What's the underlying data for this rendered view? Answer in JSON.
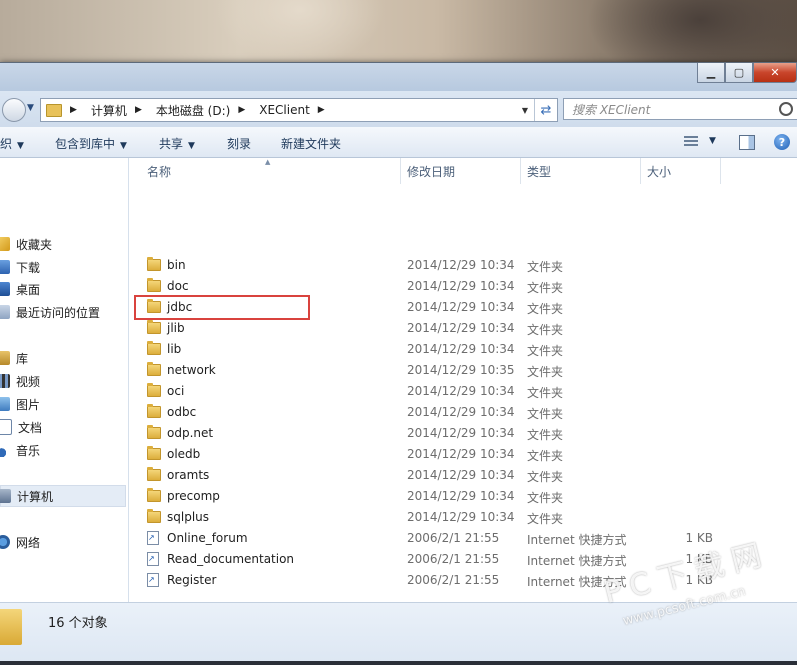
{
  "address": {
    "crumbs": [
      "计算机",
      "本地磁盘 (D:)",
      "XEClient"
    ]
  },
  "search": {
    "placeholder": "搜索 XEClient"
  },
  "toolbar": {
    "organize": "织",
    "include_in_library": "包含到库中",
    "share": "共享",
    "burn": "刻录",
    "new_folder": "新建文件夹"
  },
  "sidebar": {
    "favorites": "收藏夹",
    "downloads": "下载",
    "desktop": "桌面",
    "recent": "最近访问的位置",
    "libraries": "库",
    "videos": "视频",
    "pictures": "图片",
    "documents": "文档",
    "music": "音乐",
    "computer": "计算机",
    "network": "网络"
  },
  "columns": {
    "name": "名称",
    "date": "修改日期",
    "type": "类型",
    "size": "大小"
  },
  "files": [
    {
      "name": "bin",
      "date": "2014/12/29 10:34",
      "type": "文件夹",
      "size": "",
      "kind": "folder"
    },
    {
      "name": "doc",
      "date": "2014/12/29 10:34",
      "type": "文件夹",
      "size": "",
      "kind": "folder"
    },
    {
      "name": "jdbc",
      "date": "2014/12/29 10:34",
      "type": "文件夹",
      "size": "",
      "kind": "folder"
    },
    {
      "name": "jlib",
      "date": "2014/12/29 10:34",
      "type": "文件夹",
      "size": "",
      "kind": "folder"
    },
    {
      "name": "lib",
      "date": "2014/12/29 10:34",
      "type": "文件夹",
      "size": "",
      "kind": "folder"
    },
    {
      "name": "network",
      "date": "2014/12/29 10:35",
      "type": "文件夹",
      "size": "",
      "kind": "folder"
    },
    {
      "name": "oci",
      "date": "2014/12/29 10:34",
      "type": "文件夹",
      "size": "",
      "kind": "folder"
    },
    {
      "name": "odbc",
      "date": "2014/12/29 10:34",
      "type": "文件夹",
      "size": "",
      "kind": "folder"
    },
    {
      "name": "odp.net",
      "date": "2014/12/29 10:34",
      "type": "文件夹",
      "size": "",
      "kind": "folder"
    },
    {
      "name": "oledb",
      "date": "2014/12/29 10:34",
      "type": "文件夹",
      "size": "",
      "kind": "folder"
    },
    {
      "name": "oramts",
      "date": "2014/12/29 10:34",
      "type": "文件夹",
      "size": "",
      "kind": "folder"
    },
    {
      "name": "precomp",
      "date": "2014/12/29 10:34",
      "type": "文件夹",
      "size": "",
      "kind": "folder"
    },
    {
      "name": "sqlplus",
      "date": "2014/12/29 10:34",
      "type": "文件夹",
      "size": "",
      "kind": "folder"
    },
    {
      "name": "Online_forum",
      "date": "2006/2/1 21:55",
      "type": "Internet 快捷方式",
      "size": "1 KB",
      "kind": "shortcut"
    },
    {
      "name": "Read_documentation",
      "date": "2006/2/1 21:55",
      "type": "Internet 快捷方式",
      "size": "1 KB",
      "kind": "shortcut"
    },
    {
      "name": "Register",
      "date": "2006/2/1 21:55",
      "type": "Internet 快捷方式",
      "size": "1 KB",
      "kind": "shortcut"
    }
  ],
  "status": {
    "count": "16 个对象"
  },
  "watermark": {
    "main": "PC下载网",
    "sub": "www.pcsoft.com.cn"
  },
  "colors": {
    "highlight": "#d9433e",
    "accent": "#1e395b"
  }
}
